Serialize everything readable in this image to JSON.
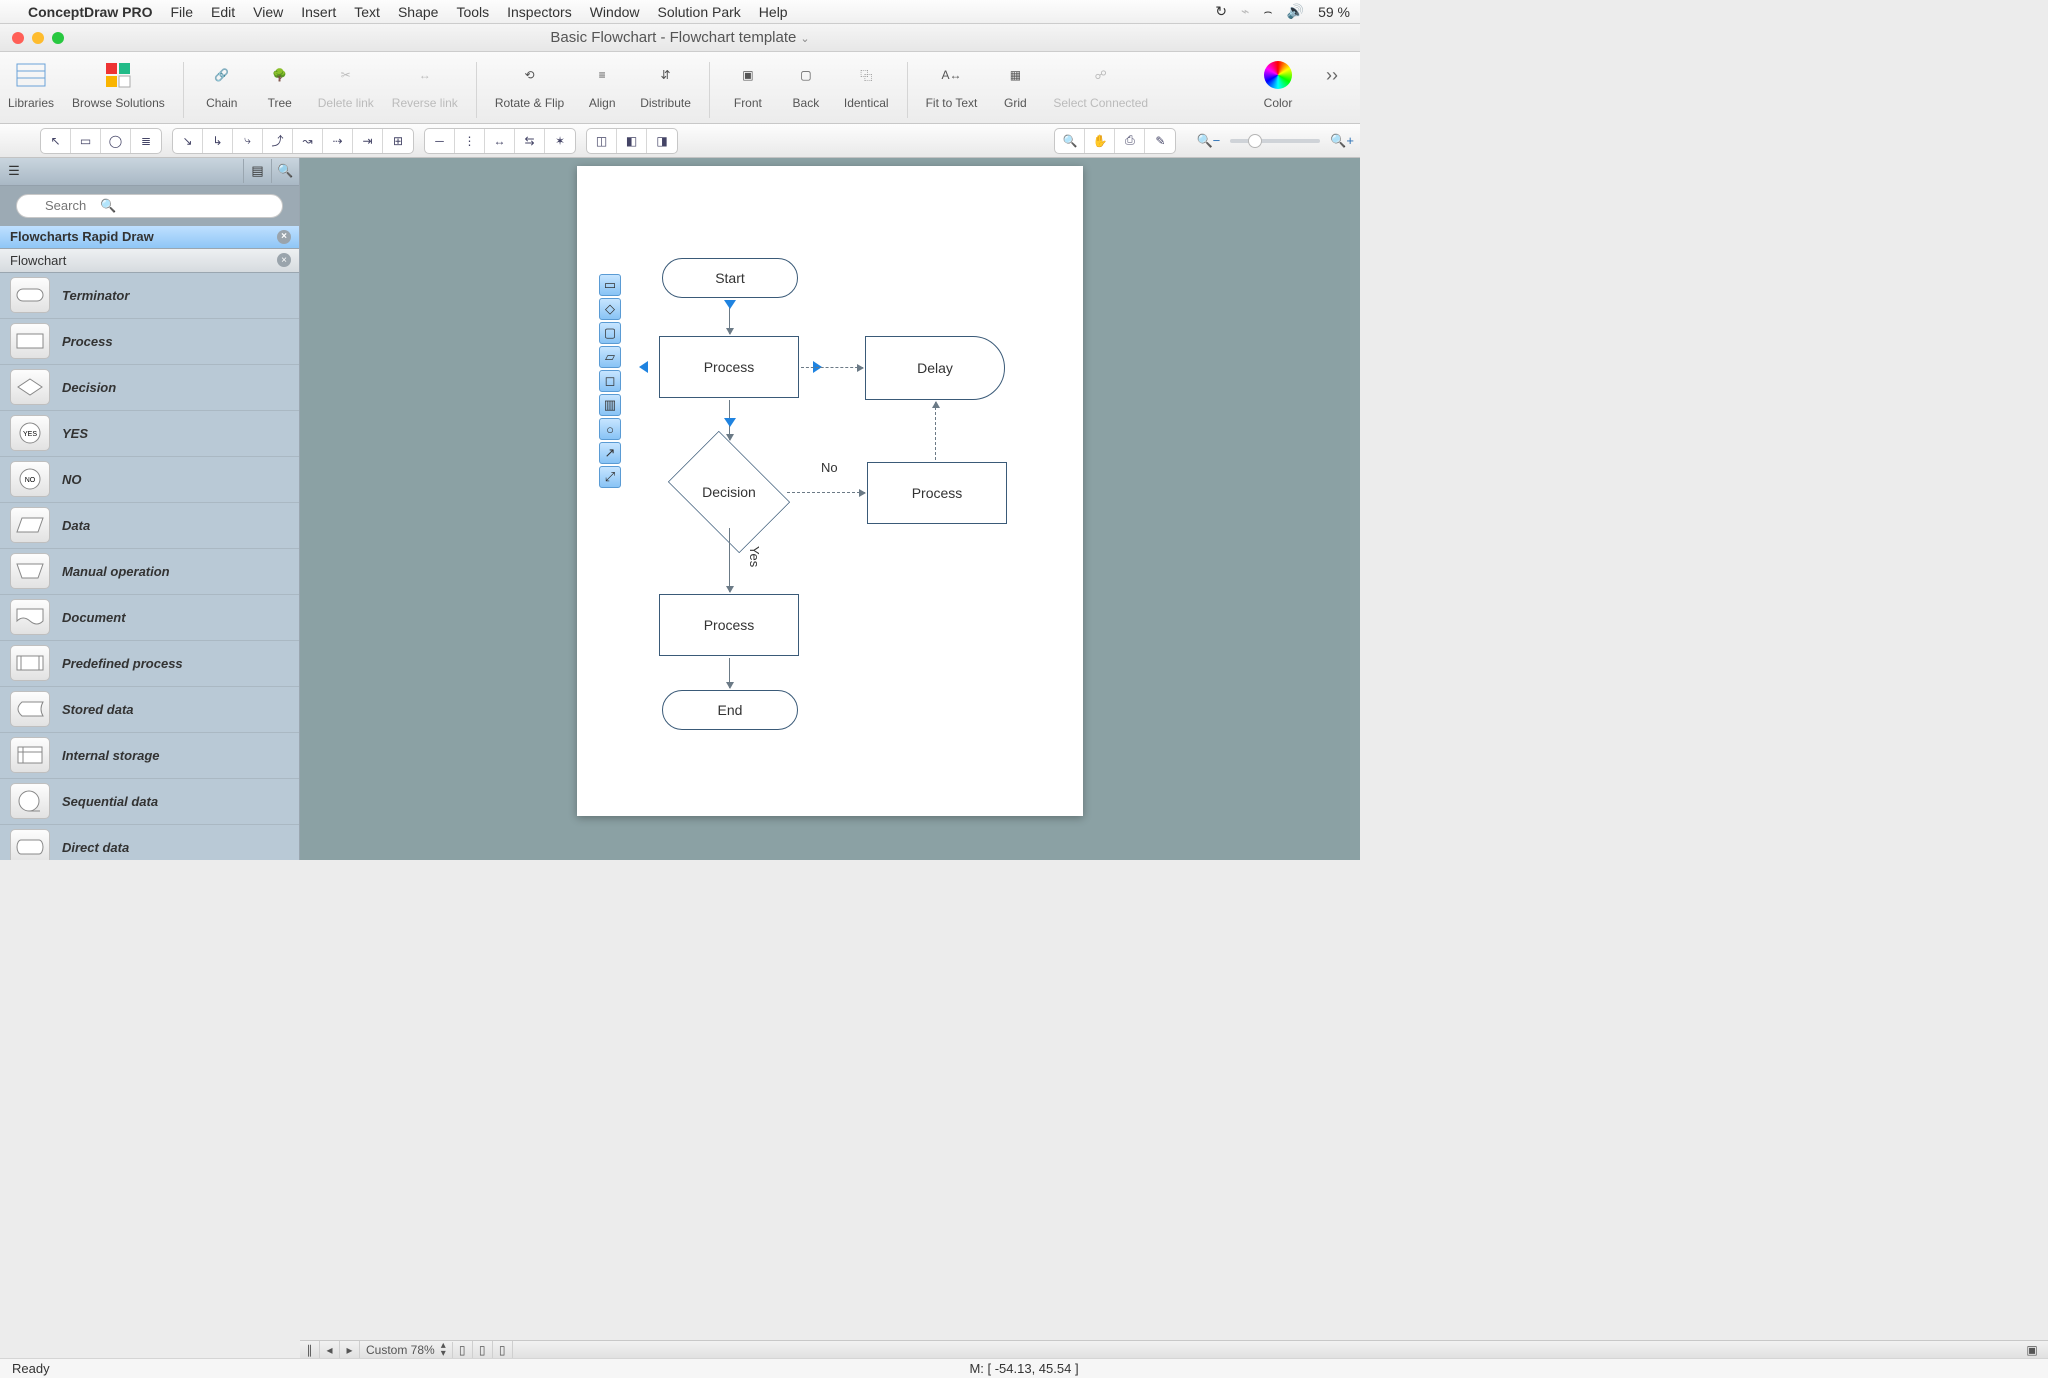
{
  "menubar": {
    "app": "ConceptDraw PRO",
    "items": [
      "File",
      "Edit",
      "View",
      "Insert",
      "Text",
      "Shape",
      "Tools",
      "Inspectors",
      "Window",
      "Solution Park",
      "Help"
    ],
    "battery": "59 %"
  },
  "window": {
    "title": "Basic Flowchart - Flowchart template"
  },
  "toolbar": {
    "libraries": "Libraries",
    "browse": "Browse Solutions",
    "chain": "Chain",
    "tree": "Tree",
    "delete_link": "Delete link",
    "reverse_link": "Reverse link",
    "rotate_flip": "Rotate & Flip",
    "align": "Align",
    "distribute": "Distribute",
    "front": "Front",
    "back": "Back",
    "identical": "Identical",
    "fit_text": "Fit to Text",
    "grid": "Grid",
    "select_connected": "Select Connected",
    "color": "Color"
  },
  "sidebar": {
    "search_placeholder": "Search",
    "libs": {
      "rapid": "Flowcharts Rapid Draw",
      "flowchart": "Flowchart"
    },
    "shapes": [
      "Terminator",
      "Process",
      "Decision",
      "YES",
      "NO",
      "Data",
      "Manual operation",
      "Document",
      "Predefined process",
      "Stored data",
      "Internal storage",
      "Sequential data",
      "Direct data"
    ]
  },
  "canvas": {
    "start": "Start",
    "process": "Process",
    "delay": "Delay",
    "decision": "Decision",
    "no": "No",
    "yes": "Yes",
    "end": "End"
  },
  "hstrip": {
    "zoom_label": "Custom 78%"
  },
  "status": {
    "ready": "Ready",
    "coords": "M: [ -54.13, 45.54 ]"
  }
}
